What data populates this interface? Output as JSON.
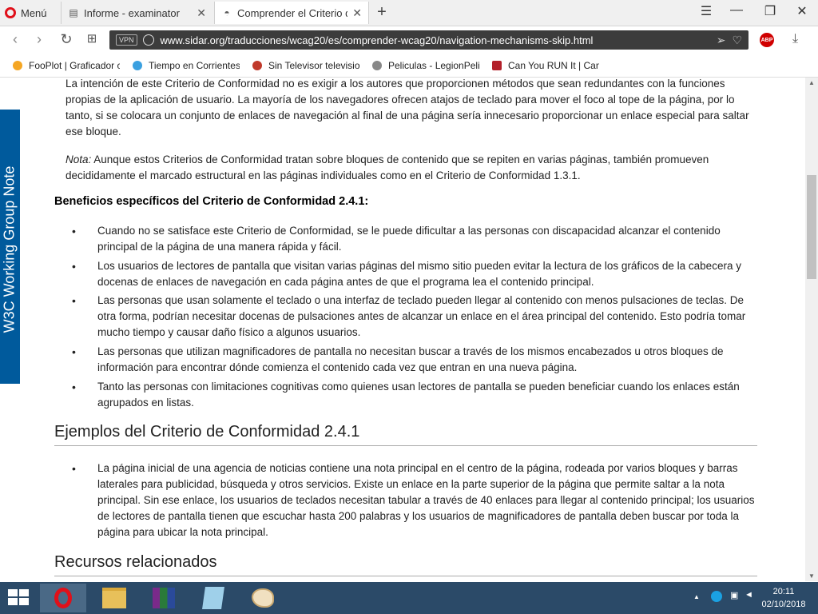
{
  "browser": {
    "menu_label": "Menú",
    "tabs": [
      {
        "title": "Informe - examinator",
        "icon": "page-icon"
      },
      {
        "title": "Comprender el Criterio de",
        "icon": "spy-icon"
      }
    ],
    "address": {
      "vpn": "VPN",
      "url": "www.sidar.org/traducciones/wcag20/es/comprender-wcag20/navigation-mechanisms-skip.html"
    },
    "abp_label": "ABP",
    "bookmarks": [
      "FooPlot | Graficador c",
      "Tiempo en Corrientes",
      "Sin Televisor televisio",
      "Peliculas - LegionPeli",
      "Can You RUN It | Can"
    ]
  },
  "page": {
    "sidebar_label": "W3C Working Group Note",
    "intro_paragraph": "La intención de este Criterio de Conformidad no es exigir a los autores que proporcionen métodos que sean redundantes con la funciones propias de la aplicación de usuario. La mayoría de los navegadores ofrecen atajos de teclado para mover el foco al tope de la página, por lo tanto, si se colocara un conjunto de enlaces de navegación al final de una página sería innecesario proporcionar un enlace especial para saltar ese bloque.",
    "note_label": "Nota:",
    "note_text": " Aunque estos Criterios de Conformidad tratan sobre bloques de contenido que se repiten en varias páginas, también promueven decididamente el marcado estructural en las páginas individuales como en el Criterio de Conformidad 1.3.1.",
    "benefits_heading": "Beneficios específicos del Criterio de Conformidad 2.4.1:",
    "benefits": [
      "Cuando no se satisface este Criterio de Conformidad, se le puede dificultar a las personas con discapacidad alcanzar el contenido principal de la página de una manera rápida y fácil.",
      "Los usuarios de lectores de pantalla que visitan varias páginas del mismo sitio pueden evitar la lectura de los gráficos de la cabecera y docenas de enlaces de navegación en cada página antes de que el programa lea el contenido principal.",
      "Las personas que usan solamente el teclado o una interfaz de teclado pueden llegar al contenido con menos pulsaciones de teclas. De otra forma, podrían necesitar docenas de pulsaciones antes de alcanzar un enlace en el área principal del contenido. Esto podría tomar mucho tiempo y causar daño físico a algunos usuarios.",
      "Las personas que utilizan magnificadores de pantalla no necesitan buscar a través de los mismos encabezados u otros bloques de información para encontrar dónde comienza el contenido cada vez que entran en una nueva página.",
      "Tanto las personas con limitaciones cognitivas como quienes usan lectores de pantalla se pueden beneficiar cuando los enlaces están agrupados en listas."
    ],
    "examples_heading": "Ejemplos del Criterio de Conformidad 2.4.1",
    "examples": [
      "La página inicial de una agencia de noticias contiene una nota principal en el centro de la página, rodeada por varios bloques y barras laterales para publicidad, búsqueda y otros servicios. Existe un enlace en la parte superior de la página que permite saltar a la nota principal. Sin ese enlace, los usuarios de teclados necesitan tabular a través de 40 enlaces para llegar al contenido principal; los usuarios de lectores de pantalla tienen que escuchar hasta 200 palabras y los usuarios de magnificadores de pantalla deben buscar por toda la página para ubicar la nota principal."
    ],
    "resources_heading": "Recursos relacionados"
  },
  "taskbar": {
    "time": "20:11",
    "date": "02/10/2018"
  },
  "colors": {
    "sidebar_blue": "#005a9c",
    "taskbar": "#2b4a68",
    "opera_red": "#e0101a"
  }
}
